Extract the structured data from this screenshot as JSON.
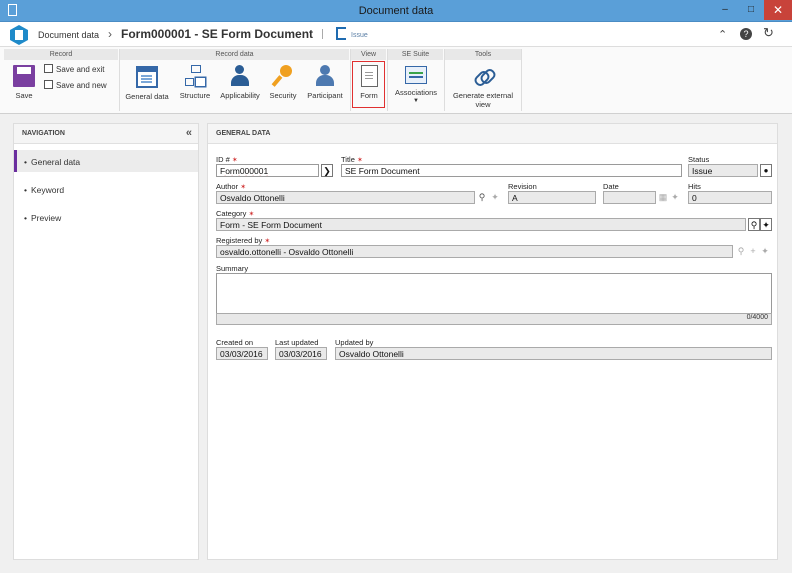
{
  "window": {
    "title": "Document data"
  },
  "header": {
    "breadcrumb": "Document data",
    "title": "Form000001 - SE Form Document",
    "status_link": "Issue"
  },
  "ribbon": {
    "groups": {
      "record": "Record",
      "record_data": "Record data",
      "view": "View",
      "se_suite": "SE Suite",
      "tools": "Tools"
    },
    "buttons": {
      "save": "Save",
      "save_and_exit": "Save and exit",
      "save_and_new": "Save and new",
      "general_data": "General data",
      "structure": "Structure",
      "applicability": "Applicability",
      "security": "Security",
      "participant": "Participant",
      "form": "Form",
      "associations": "Associations",
      "generate_external_view_1": "Generate external",
      "generate_external_view_2": "view"
    }
  },
  "navigation": {
    "title": "NAVIGATION",
    "items": [
      "General data",
      "Keyword",
      "Preview"
    ]
  },
  "general_data": {
    "title": "GENERAL DATA",
    "labels": {
      "id": "ID #",
      "title": "Title",
      "status": "Status",
      "author": "Author",
      "revision": "Revision",
      "date": "Date",
      "hits": "Hits",
      "category": "Category",
      "registered_by": "Registered by",
      "summary": "Summary",
      "created_on": "Created on",
      "last_updated": "Last updated",
      "updated_by": "Updated by"
    },
    "values": {
      "id": "Form000001",
      "title": "SE Form Document",
      "status": "Issue",
      "author": "Osvaldo Ottonelli",
      "revision": "A",
      "date": "",
      "hits": "0",
      "category": "Form - SE Form Document",
      "registered_by": "osvaldo.ottonelli - Osvaldo Ottonelli",
      "summary": "",
      "summary_counter": "0/4000",
      "created_on": "03/03/2016",
      "last_updated": "03/03/2016",
      "updated_by": "Osvaldo Ottonelli"
    }
  },
  "colors": {
    "accent": "#6a2e9e",
    "titlebar": "#5a9fd8",
    "close": "#c8433a",
    "required": "#d03030",
    "highlight": "#e03030"
  }
}
